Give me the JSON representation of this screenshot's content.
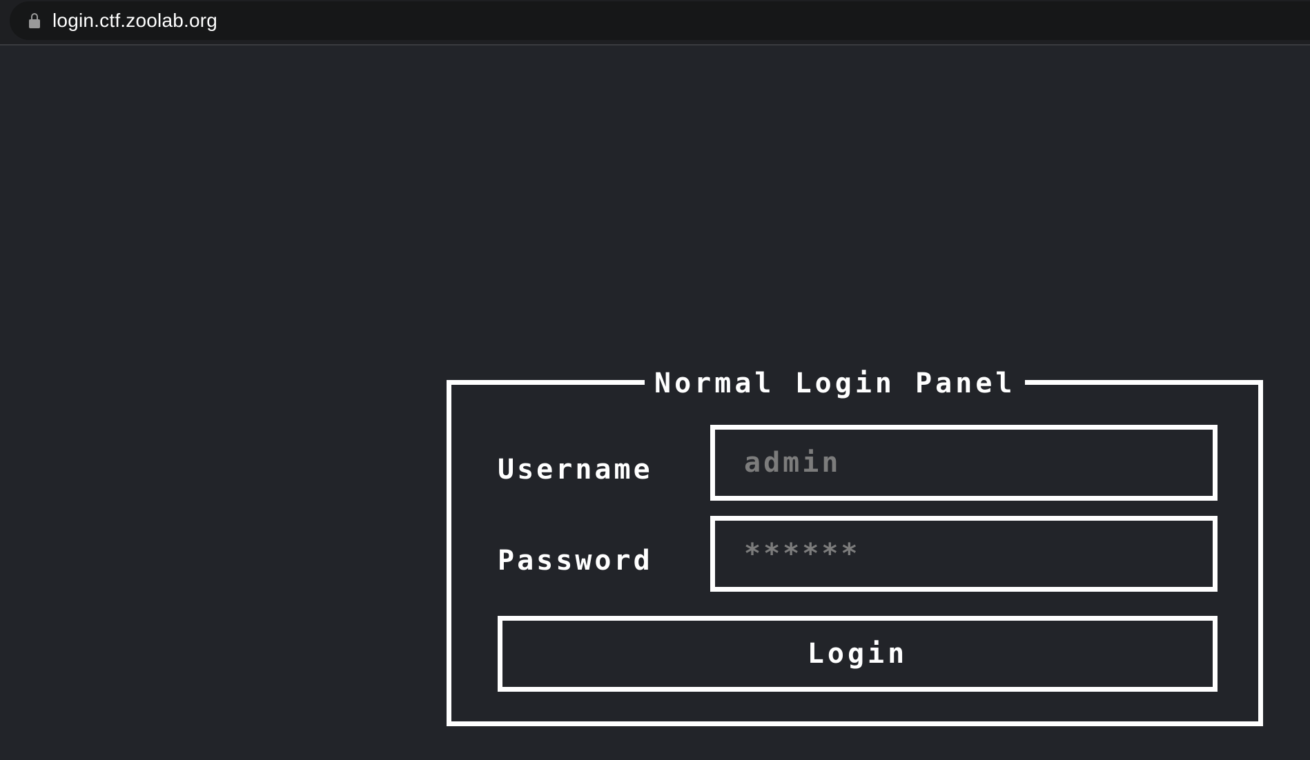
{
  "browser": {
    "url": "login.ctf.zoolab.org",
    "lock_icon": "lock-icon"
  },
  "panel": {
    "title": "Normal Login Panel",
    "username_label": "Username",
    "username_placeholder": "admin",
    "username_value": "",
    "password_label": "Password",
    "password_placeholder": "******",
    "password_value": "",
    "login_label": "Login"
  },
  "colors": {
    "background": "#222429",
    "border": "#ffffff",
    "placeholder": "#7c7c7c"
  }
}
